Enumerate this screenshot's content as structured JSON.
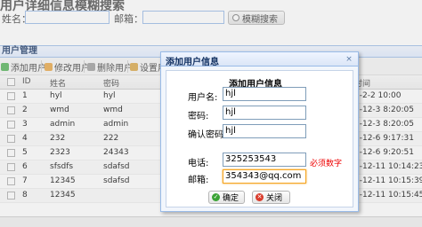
{
  "search": {
    "title": "用户详细信息模糊搜索",
    "name_label": "姓名：",
    "email_label": "邮箱：",
    "button_label": "模糊搜索"
  },
  "panel": {
    "title": "用户管理"
  },
  "toolbar": {
    "add": "添加用户",
    "edit": "修改用户",
    "delete": "删除用户",
    "set": "设置用户"
  },
  "grid": {
    "headers": {
      "id": "ID",
      "name": "姓名",
      "password": "密码",
      "time": "时间"
    },
    "rows": [
      {
        "id": "1",
        "name": "hyl",
        "password": "hyl",
        "time": "2-2-2 10:00"
      },
      {
        "id": "2",
        "name": "wmd",
        "password": "wmd",
        "time": "2-12-3 8:20:05"
      },
      {
        "id": "3",
        "name": "admin",
        "password": "admin",
        "time": "2-12-3 8:20:05"
      },
      {
        "id": "4",
        "name": "232",
        "password": "222",
        "time": "2-12-6 9:17:31"
      },
      {
        "id": "5",
        "name": "2323",
        "password": "24343",
        "time": "2-12-6 9:20:51"
      },
      {
        "id": "6",
        "name": "sfsdfs",
        "password": "sdafsd",
        "time": "2-12-11 10:14:23"
      },
      {
        "id": "7",
        "name": "12345",
        "password": "sdafsd",
        "time": "2-12-11 10:15:39"
      },
      {
        "id": "8",
        "name": "12345",
        "password": "",
        "time": "2-12-11 10:15:45"
      }
    ]
  },
  "dialog": {
    "title": "添加用户信息",
    "close": "×",
    "form_title": "添加用户信息",
    "username_label": "用户名:",
    "username_value": "hjl",
    "password_label": "密码:",
    "password_value": "hjl",
    "confirm_label": "确认密码:",
    "confirm_value": "hjl",
    "phone_label": "电话:",
    "phone_value": "325253543",
    "required_note": "必须数字",
    "email_label": "邮箱:",
    "email_value": "354343@qq.com",
    "ok_label": "确定",
    "close_label": "关闭"
  },
  "colors": {
    "panel_header": "#e0ecff",
    "border_blue": "#99bbe8",
    "required_red": "#ee0000",
    "ok_green": "#3aa335",
    "close_red": "#d93b2b",
    "focus_orange": "#f5a623"
  },
  "icons": [
    "search-icon",
    "add-icon",
    "edit-icon",
    "delete-icon",
    "settings-icon",
    "check-icon",
    "cancel-icon",
    "close-icon"
  ]
}
